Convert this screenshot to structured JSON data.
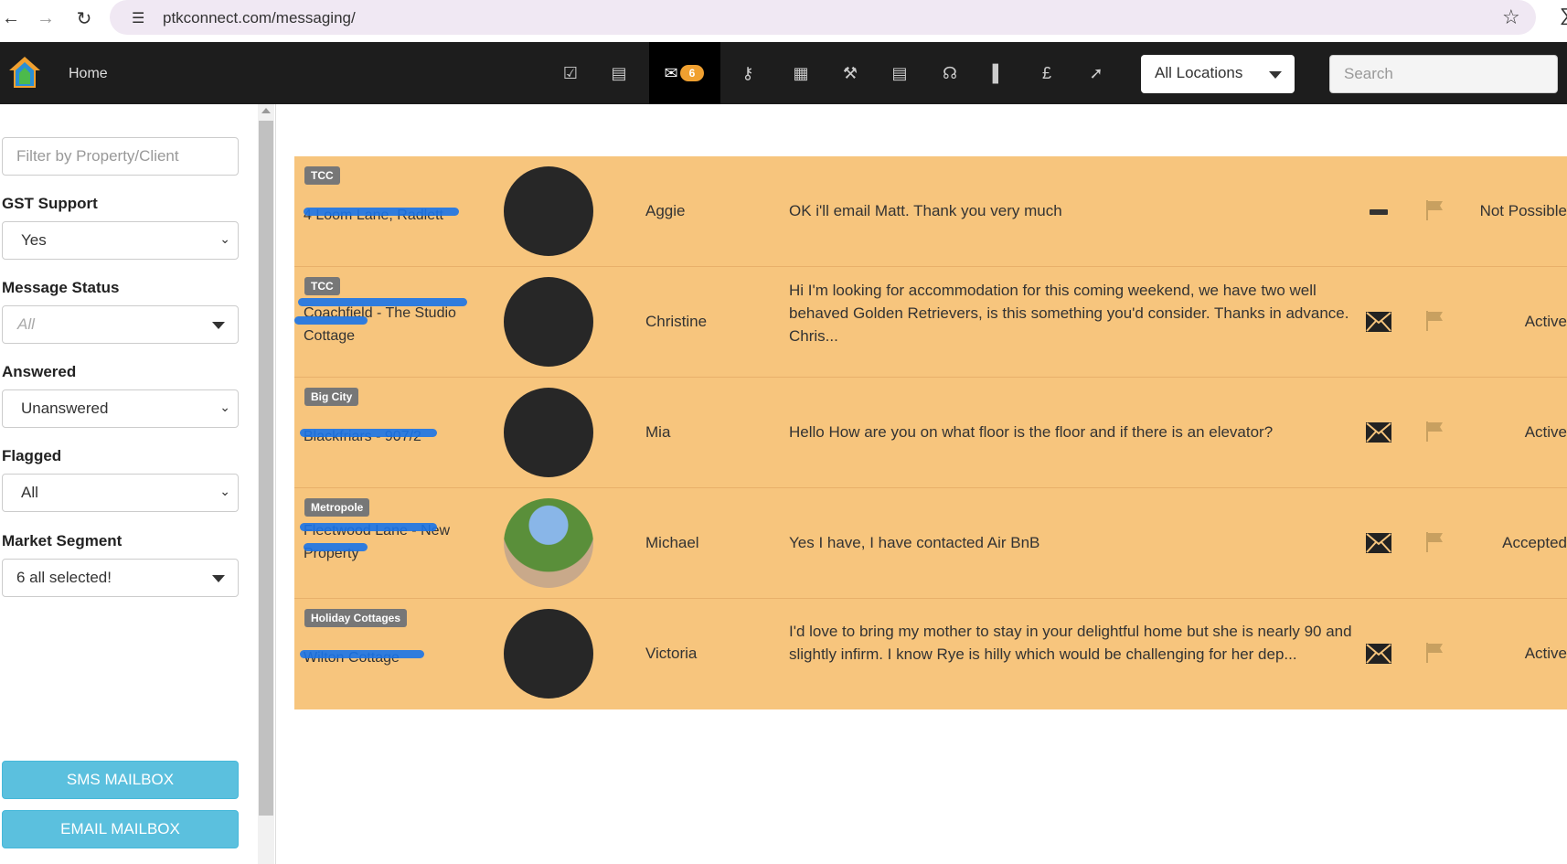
{
  "browser": {
    "url": "ptkconnect.com/messaging/"
  },
  "header": {
    "home_label": "Home",
    "mail_badge": "6",
    "location_select": "All Locations",
    "search_placeholder": "Search"
  },
  "sidebar": {
    "filter_placeholder": "Filter by Property/Client",
    "gst_label": "GST Support",
    "gst_value": "Yes",
    "status_label": "Message Status",
    "status_value": "All",
    "answered_label": "Answered",
    "answered_value": "Unanswered",
    "flagged_label": "Flagged",
    "flagged_value": "All",
    "segment_label": "Market Segment",
    "segment_value": "6 all selected!",
    "sms_button": "SMS MAILBOX",
    "email_button": "EMAIL MAILBOX"
  },
  "messages": [
    {
      "tag": "TCC",
      "property": "4 Loom Lane, Radlett",
      "name": "Aggie",
      "text": "OK i'll email Matt. Thank you very much",
      "icon": "dash-icon",
      "status": "Not Possible"
    },
    {
      "tag": "TCC",
      "property": "Coachfield - The Studio Cottage",
      "name": "Christine",
      "text": "Hi I'm looking for accommodation for this coming weekend, we have two well behaved Golden Retrievers, is this something you'd consider. Thanks in advance. Chris...",
      "icon": "envelope-icon",
      "status": "Active"
    },
    {
      "tag": "Big City",
      "property": "Blackfriars - 907/2",
      "name": "Mia",
      "text": "Hello How are you on what floor is the floor and if there is an elevator?",
      "icon": "envelope-icon",
      "status": "Active"
    },
    {
      "tag": "Metropole",
      "property": "Fleetwood Lane - New Property",
      "name": "Michael",
      "text": "Yes I have, I have contacted Air BnB",
      "icon": "envelope-icon",
      "status": "Accepted"
    },
    {
      "tag": "Holiday Cottages",
      "property": "Wilton Cottage",
      "name": "Victoria",
      "text": "I'd love to bring my mother to stay in your delightful home but she is nearly 90 and slightly infirm. I know Rye is hilly which would be challenging for her dep...",
      "icon": "envelope-icon",
      "status": "Active"
    }
  ],
  "icons": {
    "nav": [
      "tasks-icon",
      "bus-icon",
      "mail-icon",
      "keys-icon",
      "calendar-icon",
      "wrench-icon",
      "document-icon",
      "headset-icon",
      "chart-icon",
      "pound-icon",
      "pin-icon"
    ]
  },
  "colors": {
    "row_background": "#f7c57d",
    "header_background": "#1d1d1d",
    "mailbox_button": "#5bc0de",
    "badge": "#f0a030"
  }
}
